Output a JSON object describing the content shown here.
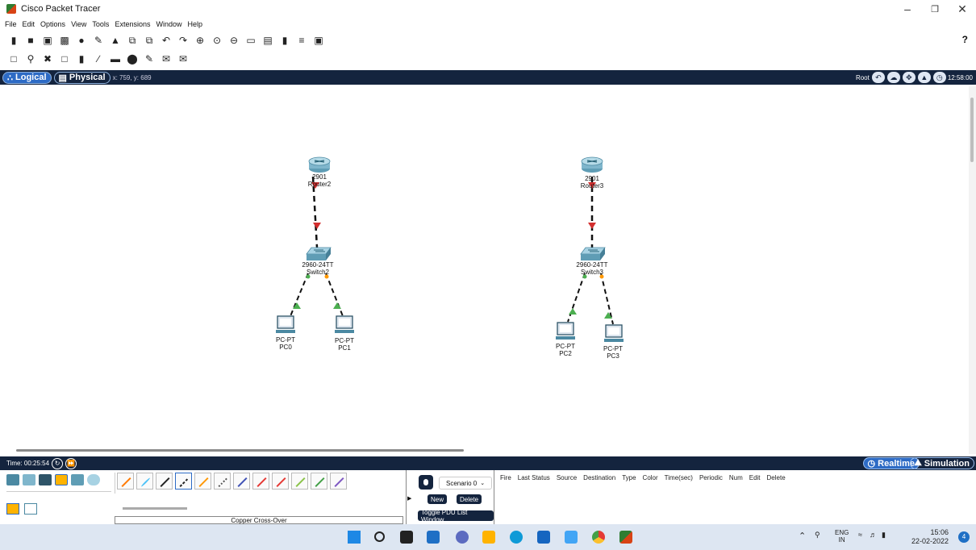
{
  "app": {
    "title": "Cisco Packet Tracer"
  },
  "menu": [
    "File",
    "Edit",
    "Options",
    "View",
    "Tools",
    "Extensions",
    "Window",
    "Help"
  ],
  "toolbar": {
    "help_label": "?"
  },
  "modebar": {
    "logical_label": "Logical",
    "physical_label": "Physical",
    "coords": "x: 759, y: 689",
    "root_label": "Root",
    "clock": "12:58:00"
  },
  "topology": {
    "devices": [
      {
        "id": "router2",
        "type": "router",
        "model": "2901",
        "name": "Router2"
      },
      {
        "id": "router3",
        "type": "router",
        "model": "2901",
        "name": "Router3"
      },
      {
        "id": "switch2",
        "type": "switch",
        "model": "2960-24TT",
        "name": "Switch2"
      },
      {
        "id": "switch3",
        "type": "switch",
        "model": "2960-24TT",
        "name": "Switch3"
      },
      {
        "id": "pc0",
        "type": "pc",
        "model": "PC-PT",
        "name": "PC0"
      },
      {
        "id": "pc1",
        "type": "pc",
        "model": "PC-PT",
        "name": "PC1"
      },
      {
        "id": "pc2",
        "type": "pc",
        "model": "PC-PT",
        "name": "PC2"
      },
      {
        "id": "pc3",
        "type": "pc",
        "model": "PC-PT",
        "name": "PC3"
      }
    ],
    "links": [
      {
        "from": "router2",
        "to": "switch2",
        "cable": "copper-cross-over",
        "status": "down"
      },
      {
        "from": "router3",
        "to": "switch3",
        "cable": "copper-cross-over",
        "status": "down"
      },
      {
        "from": "switch2",
        "to": "pc0",
        "cable": "copper-straight",
        "status": "up"
      },
      {
        "from": "switch2",
        "to": "pc1",
        "cable": "copper-straight",
        "status": "up"
      },
      {
        "from": "switch3",
        "to": "pc2",
        "cable": "copper-straight",
        "status": "up"
      },
      {
        "from": "switch3",
        "to": "pc3",
        "cable": "copper-straight",
        "status": "up"
      }
    ]
  },
  "statusbar": {
    "time": "Time: 00:25:54",
    "realtime_label": "Realtime",
    "simulation_label": "Simulation"
  },
  "bottom": {
    "cable_name": "Copper Cross-Over",
    "scenario": "Scenario 0",
    "new_label": "New",
    "delete_label": "Delete",
    "toggle_label": "Toggle PDU List Window",
    "pdu_columns": [
      "Fire",
      "Last Status",
      "Source",
      "Destination",
      "Type",
      "Color",
      "Time(sec)",
      "Periodic",
      "Num",
      "Edit",
      "Delete"
    ]
  },
  "taskbar": {
    "lang_top": "ENG",
    "lang_bottom": "IN",
    "time": "15:06",
    "date": "22-02-2022",
    "notif_count": "4"
  },
  "colors": {
    "modebar_bg": "#14243e",
    "link_down": "#d32f2f",
    "link_up": "#4caf50",
    "link_amber": "#ff9800"
  }
}
